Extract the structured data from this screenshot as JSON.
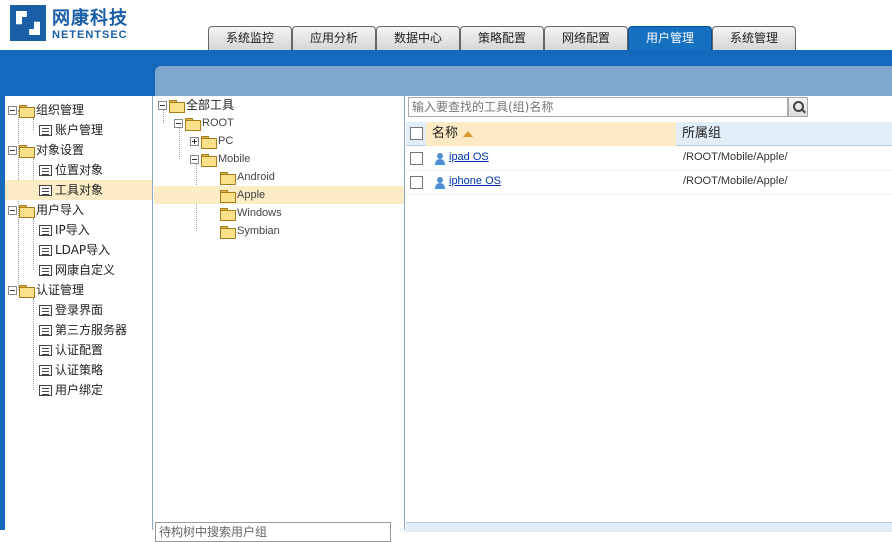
{
  "brand": {
    "cn": "网康科技",
    "en": "NETENTSEC"
  },
  "tabs": [
    {
      "label": "系统监控",
      "active": false
    },
    {
      "label": "应用分析",
      "active": false
    },
    {
      "label": "数据中心",
      "active": false
    },
    {
      "label": "策略配置",
      "active": false
    },
    {
      "label": "网络配置",
      "active": false
    },
    {
      "label": "用户管理",
      "active": true
    },
    {
      "label": "系统管理",
      "active": false
    }
  ],
  "sidebar": {
    "groups": [
      {
        "label": "组织管理",
        "items": [
          {
            "label": "账户管理"
          }
        ]
      },
      {
        "label": "对象设置",
        "items": [
          {
            "label": "位置对象"
          },
          {
            "label": "工具对象",
            "selected": true
          }
        ]
      },
      {
        "label": "用户导入",
        "items": [
          {
            "label": "IP导入"
          },
          {
            "label": "LDAP导入"
          },
          {
            "label": "网康自定义"
          }
        ]
      },
      {
        "label": "认证管理",
        "items": [
          {
            "label": "登录界面"
          },
          {
            "label": "第三方服务器"
          },
          {
            "label": "认证配置"
          },
          {
            "label": "认证策略"
          },
          {
            "label": "用户绑定"
          }
        ]
      }
    ]
  },
  "tree": {
    "root_label": "全部工具",
    "nodes": [
      {
        "label": "ROOT"
      },
      {
        "label": "PC"
      },
      {
        "label": "Mobile"
      },
      {
        "label": "Android"
      },
      {
        "label": "Apple",
        "selected": true
      },
      {
        "label": "Windows"
      },
      {
        "label": "Symbian"
      }
    ],
    "bottom_input": "待构树中搜索用户组"
  },
  "search": {
    "placeholder": "输入要查找的工具(组)名称"
  },
  "grid": {
    "columns": {
      "name": "名称",
      "group": "所属组"
    },
    "rows": [
      {
        "name": "ipad OS",
        "group": "/ROOT/Mobile/Apple/"
      },
      {
        "name": "iphone OS",
        "group": "/ROOT/Mobile/Apple/"
      }
    ]
  },
  "colors": {
    "brand_blue": "#1569bd",
    "selected_bg": "#fbecc6",
    "link": "#0033aa"
  }
}
